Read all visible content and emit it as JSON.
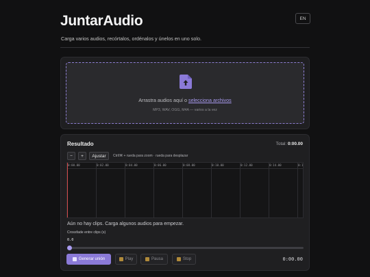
{
  "header": {
    "title": "JuntarAudio",
    "subtitle": "Carga varios audios, recórtalos, ordénalos y únelos en uno solo.",
    "lang_button": "EN"
  },
  "dropzone": {
    "text_before_link": "Arrastra audios aquí o ",
    "link_text": "selecciona archivos",
    "hint": "MP3, WAV, OGG, M4A — varios a la vez",
    "icon": "file-upload-icon"
  },
  "result": {
    "title": "Resultado",
    "total_label": "Total: ",
    "total_value": "0:00.00",
    "zoom_out_label": "−",
    "zoom_in_label": "+",
    "fit_label": "Ajustar",
    "zoom_hint": "Ctrl/⌘ + rueda para zoom · rueda para desplazar",
    "timeline_ticks": [
      "0:00.00",
      "0:02.00",
      "0:04.00",
      "0:06.00",
      "0:08.00",
      "0:10.00",
      "0:12.00",
      "0:14.00",
      "0:1"
    ],
    "empty_message": "Aún no hay clips. Carga algunos audios para empezar.",
    "crossfade_label": "Crossfade entre clips (s)",
    "crossfade_value": "0.0",
    "crossfade_level": 0
  },
  "controls": {
    "generate_label": "Generar unión",
    "play_label": "Play",
    "pause_label": "Pausa",
    "stop_label": "Stop",
    "clock": "0:00.00"
  },
  "colors": {
    "accent": "#8b7ad8",
    "link": "#a99bf0",
    "background": "#111112",
    "card": "#1f1f21",
    "playhead": "#d34b4b"
  }
}
